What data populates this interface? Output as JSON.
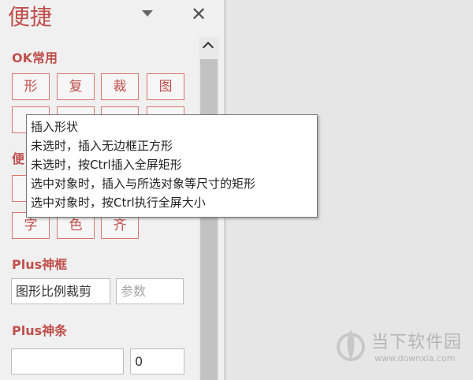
{
  "panel": {
    "title": "便捷",
    "close_symbol": "✕"
  },
  "sections": {
    "ok_common": "OK常用",
    "convenient_partial": "便",
    "plus_frame": "Plus神框",
    "plus_bar": "Plus神条"
  },
  "buttons": {
    "row1": [
      "形",
      "复",
      "裁",
      "图"
    ],
    "row2_visible": [
      "",
      "",
      "",
      ""
    ],
    "row3_visible": [
      ""
    ],
    "row4": [
      "字",
      "色",
      "齐"
    ]
  },
  "partial_glyphs": {
    "row2_left": "",
    "row3_left": ""
  },
  "fields": {
    "crop_value": "图形比例裁剪",
    "param_placeholder": "参数",
    "bar_value": "",
    "bar_number": "0"
  },
  "tooltip": {
    "lines": [
      "插入形状",
      "未选时，插入无边框正方形",
      "未选时，按Ctrl插入全屏矩形",
      "选中对象时，插入与所选对象等尺寸的矩形",
      "选中对象时，按Ctrl执行全屏大小"
    ]
  },
  "watermark": {
    "name": "当下软件园",
    "url": "www.downxia.com"
  },
  "colors": {
    "accent": "#c0504d",
    "pane_bg": "#f0f0f0",
    "right_bg": "#e6e6e6"
  }
}
